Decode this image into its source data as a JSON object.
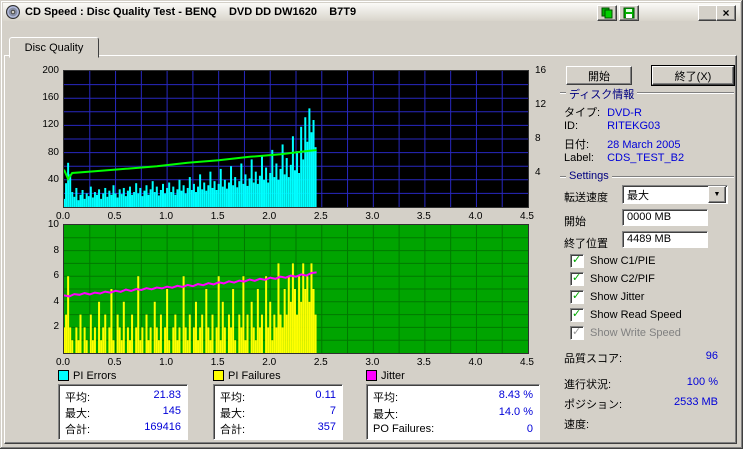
{
  "window": {
    "title": "CD Speed : Disc Quality Test - BENQ    DVD DD DW1620    B7T9"
  },
  "tabs": {
    "disc_quality": "Disc Quality"
  },
  "chart_data": [
    {
      "type": "bar",
      "title": "PI Errors / Read Speed",
      "bg": "#000000",
      "grid_color": "#2828c0",
      "xlim": [
        0,
        4.5
      ],
      "x_grid_step": 0.25,
      "y_grid_step": 20,
      "x_ticks": [
        "0.0",
        "0.5",
        "1.0",
        "1.5",
        "2.0",
        "2.5",
        "3.0",
        "3.5",
        "4.0",
        "4.5"
      ],
      "ylim_left": [
        0,
        200
      ],
      "y_ticks_left": [
        200,
        160,
        120,
        80,
        40
      ],
      "ylim_right": [
        0,
        16
      ],
      "y_ticks_right": [
        16,
        12,
        8,
        4
      ],
      "series": [
        {
          "name": "PI Errors",
          "type": "bar",
          "axis": "left",
          "color": "#00ffff",
          "x_start": 0,
          "x_step": 0.02,
          "values": [
            12,
            35,
            65,
            48,
            22,
            15,
            28,
            10,
            18,
            25,
            12,
            20,
            16,
            30,
            14,
            22,
            18,
            26,
            12,
            20,
            28,
            15,
            24,
            18,
            32,
            20,
            14,
            26,
            19,
            28,
            16,
            24,
            30,
            18,
            22,
            35,
            20,
            28,
            16,
            24,
            32,
            18,
            26,
            38,
            22,
            30,
            17,
            25,
            34,
            20,
            28,
            36,
            22,
            30,
            18,
            26,
            40,
            24,
            32,
            20,
            28,
            44,
            25,
            34,
            22,
            30,
            48,
            26,
            36,
            24,
            32,
            52,
            28,
            38,
            25,
            34,
            56,
            30,
            40,
            27,
            36,
            60,
            32,
            44,
            29,
            38,
            64,
            34,
            48,
            31,
            42,
            70,
            36,
            52,
            34,
            46,
            76,
            40,
            58,
            36,
            50,
            84,
            44,
            64,
            40,
            56,
            92,
            48,
            72,
            44,
            62,
            104,
            54,
            82,
            50,
            118,
            70,
            132,
            96,
            145,
            110,
            128,
            88
          ]
        },
        {
          "name": "Read Speed",
          "type": "line",
          "axis": "right",
          "color": "#00ff00",
          "points": [
            [
              0,
              4.4
            ],
            [
              0.04,
              3.3
            ],
            [
              0.08,
              4.0
            ],
            [
              0.3,
              4.2
            ],
            [
              0.6,
              4.5
            ],
            [
              0.9,
              4.8
            ],
            [
              1.2,
              5.2
            ],
            [
              1.5,
              5.5
            ],
            [
              1.8,
              5.9
            ],
            [
              2.1,
              6.2
            ],
            [
              2.3,
              6.5
            ],
            [
              2.45,
              6.7
            ]
          ]
        }
      ]
    },
    {
      "type": "bar",
      "title": "PI Failures / Jitter",
      "bg": "#00a400",
      "grid_color": "#007800",
      "xlim": [
        0,
        4.5
      ],
      "x_grid_step": 0.25,
      "y_grid_step": 1,
      "x_ticks": [
        "0.0",
        "0.5",
        "1.0",
        "1.5",
        "2.0",
        "2.5",
        "3.0",
        "3.5",
        "4.0",
        "4.5"
      ],
      "ylim_left": [
        0,
        10
      ],
      "y_ticks_left": [
        10,
        8,
        6,
        4,
        2
      ],
      "series": [
        {
          "name": "PI Failures",
          "type": "bar",
          "axis": "left",
          "color": "#ffff00",
          "x_start": 0,
          "x_step": 0.02,
          "values": [
            2,
            3,
            6,
            2,
            1,
            0,
            2,
            1,
            3,
            0,
            2,
            1,
            0,
            3,
            1,
            2,
            0,
            4,
            1,
            2,
            3,
            0,
            2,
            5,
            1,
            0,
            3,
            2,
            1,
            4,
            0,
            2,
            1,
            3,
            0,
            2,
            6,
            1,
            2,
            0,
            3,
            1,
            2,
            0,
            4,
            2,
            1,
            3,
            0,
            2,
            5,
            1,
            0,
            2,
            3,
            1,
            2,
            0,
            6,
            2,
            1,
            3,
            0,
            2,
            4,
            1,
            2,
            3,
            0,
            5,
            2,
            1,
            3,
            0,
            2,
            6,
            1,
            4,
            2,
            0,
            3,
            2,
            5,
            1,
            0,
            3,
            2,
            6,
            1,
            3,
            0,
            4,
            2,
            1,
            5,
            2,
            3,
            0,
            6,
            2,
            4,
            1,
            3,
            2,
            7,
            3,
            2,
            5,
            3,
            6,
            4,
            7,
            5,
            3,
            6,
            4,
            7,
            5,
            6,
            4,
            7,
            5,
            3
          ]
        },
        {
          "name": "Jitter",
          "type": "line",
          "axis": "left",
          "color": "#ff00ff",
          "x_start": 0,
          "x_step": 0.05,
          "values": [
            4.5,
            4.42,
            4.6,
            4.55,
            4.68,
            4.58,
            4.72,
            4.65,
            4.8,
            4.72,
            4.86,
            4.78,
            4.95,
            4.85,
            5.0,
            4.92,
            5.06,
            4.98,
            5.12,
            5.05,
            5.18,
            5.1,
            5.25,
            5.16,
            5.32,
            5.22,
            5.38,
            5.3,
            5.45,
            5.36,
            5.52,
            5.44,
            5.6,
            5.5,
            5.66,
            5.58,
            5.74,
            5.64,
            5.8,
            5.72,
            5.88,
            5.8,
            5.96,
            5.88,
            6.05,
            5.96,
            6.14,
            6.05,
            6.25,
            6.3
          ]
        }
      ]
    }
  ],
  "stats": {
    "pi_errors": {
      "legend": "PI Errors",
      "color": "#00ffff",
      "rows": [
        {
          "label": "平均:",
          "value": "21.83"
        },
        {
          "label": "最大:",
          "value": "145"
        },
        {
          "label": "合計:",
          "value": "169416"
        }
      ]
    },
    "pi_failures": {
      "legend": "PI Failures",
      "color": "#ffff00",
      "rows": [
        {
          "label": "平均:",
          "value": "0.11"
        },
        {
          "label": "最大:",
          "value": "7"
        },
        {
          "label": "合計:",
          "value": "357"
        }
      ]
    },
    "jitter": {
      "legend": "Jitter",
      "color": "#ff00ff",
      "rows": [
        {
          "label": "平均:",
          "value": "8.43 %"
        },
        {
          "label": "最大:",
          "value": "14.0 %"
        },
        {
          "label": "PO Failures:",
          "value": "0"
        }
      ]
    }
  },
  "side": {
    "start_button": "開始",
    "exit_button": "終了(X)",
    "disc_info": {
      "title": "ディスク情報",
      "rows": [
        {
          "label": "タイプ:",
          "value": "DVD-R"
        },
        {
          "label": "ID:",
          "value": "RITEKG03"
        },
        {
          "label": "日付:",
          "value": "28 March 2005"
        },
        {
          "label": "Label:",
          "value": "CDS_TEST_B2"
        }
      ]
    },
    "settings": {
      "title": "Settings",
      "speed_label": "転送速度",
      "speed_value": "最大",
      "start_label": "開始",
      "start_value": "0000 MB",
      "end_label": "終了位置",
      "end_value": "4489 MB",
      "checkboxes": [
        {
          "label": "Show C1/PIE",
          "checked": true,
          "disabled": false
        },
        {
          "label": "Show C2/PIF",
          "checked": true,
          "disabled": false
        },
        {
          "label": "Show Jitter",
          "checked": true,
          "disabled": false
        },
        {
          "label": "Show Read Speed",
          "checked": true,
          "disabled": false
        },
        {
          "label": "Show Write Speed",
          "checked": true,
          "disabled": true
        }
      ]
    },
    "quality_label": "品質スコア:",
    "quality_value": "96",
    "progress_label": "進行状況:",
    "progress_value": "100 %",
    "position_label": "ポジション:",
    "position_value": "2533 MB",
    "speed_label": "速度:",
    "speed_value": ""
  }
}
